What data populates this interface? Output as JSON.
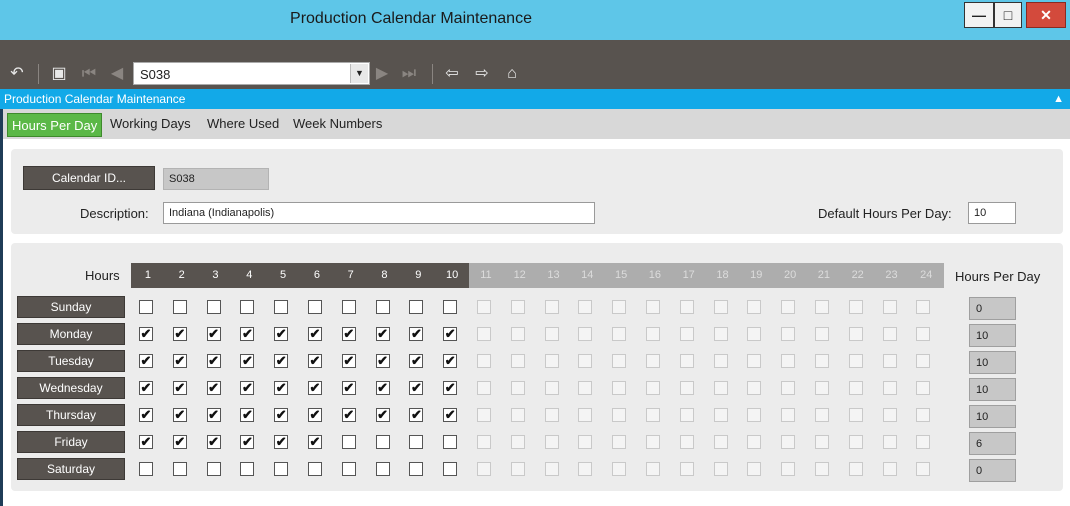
{
  "window": {
    "title": "Production Calendar Maintenance"
  },
  "toolbar": {
    "calendar_select_value": "S038"
  },
  "panel_title": "Production Calendar Maintenance",
  "tabs": [
    "Hours Per Day",
    "Working Days",
    "Where Used",
    "Week Numbers"
  ],
  "form": {
    "calendar_id_label": "Calendar ID...",
    "calendar_id_value": "S038",
    "description_label": "Description:",
    "description_value": "Indiana (Indianapolis)",
    "default_hours_label": "Default Hours Per Day:",
    "default_hours_value": "10"
  },
  "grid": {
    "hours_label": "Hours",
    "hours_per_day_label": "Hours Per Day",
    "hours": [
      "1",
      "2",
      "3",
      "4",
      "5",
      "6",
      "7",
      "8",
      "9",
      "10",
      "11",
      "12",
      "13",
      "14",
      "15",
      "16",
      "17",
      "18",
      "19",
      "20",
      "21",
      "22",
      "23",
      "24"
    ],
    "enabled_hours": 10,
    "days": [
      {
        "name": "Sunday",
        "hours_per_day": "0",
        "checked": 0
      },
      {
        "name": "Monday",
        "hours_per_day": "10",
        "checked": 10
      },
      {
        "name": "Tuesday",
        "hours_per_day": "10",
        "checked": 10
      },
      {
        "name": "Wednesday",
        "hours_per_day": "10",
        "checked": 10
      },
      {
        "name": "Thursday",
        "hours_per_day": "10",
        "checked": 10
      },
      {
        "name": "Friday",
        "hours_per_day": "6",
        "checked": 6
      },
      {
        "name": "Saturday",
        "hours_per_day": "0",
        "checked": 0
      }
    ]
  }
}
